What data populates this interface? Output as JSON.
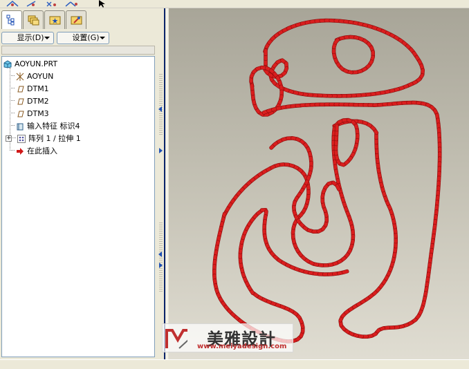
{
  "panel": {
    "show_menu_label": "显示(D)",
    "settings_menu_label": "设置(G)"
  },
  "tree": {
    "items": [
      {
        "label": "AOYUN.PRT",
        "icon": "part-icon"
      },
      {
        "label": "AOYUN",
        "icon": "csys-icon"
      },
      {
        "label": "DTM1",
        "icon": "datum-plane-icon"
      },
      {
        "label": "DTM2",
        "icon": "datum-plane-icon"
      },
      {
        "label": "DTM3",
        "icon": "datum-plane-icon"
      },
      {
        "label": "输入特征 标识4",
        "icon": "import-feature-icon"
      },
      {
        "label": "阵列 1 / 拉伸 1",
        "icon": "pattern-icon"
      },
      {
        "label": "在此插入",
        "icon": "insert-here-arrow-icon"
      }
    ]
  },
  "watermark": {
    "brand": "美雅設計",
    "url": "www.meiyadesign.com"
  },
  "colors": {
    "model_red": "#d91e1e",
    "model_dark_red": "#8a0c0c",
    "viewport_top": "#a8a598",
    "viewport_bottom": "#e0ddd2",
    "selection_blue": "#1e4fb4"
  }
}
